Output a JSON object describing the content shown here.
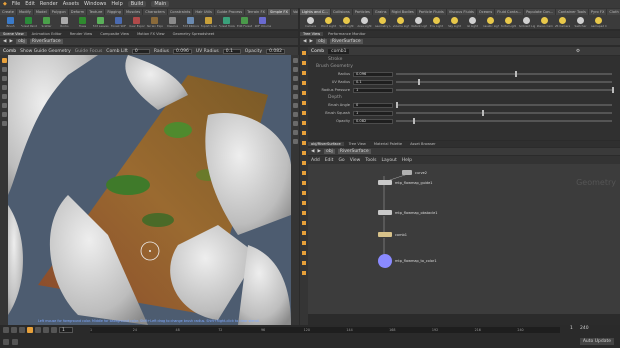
{
  "menu": {
    "items": [
      "File",
      "Edit",
      "Render",
      "Assets",
      "Windows",
      "Help"
    ],
    "build": "Build",
    "desktop": "Main"
  },
  "shelf_tabs_left": [
    "Create",
    "Modify",
    "Model",
    "Polygon",
    "Deform",
    "Texture",
    "Rigging",
    "Muscles",
    "Characters",
    "Constraints",
    "Hair Utils",
    "Guide Process",
    "Terrain FX",
    "Simple FX",
    "Volume"
  ],
  "shelf_tabs_right": [
    "Lights and C...",
    "Collisions",
    "Particles",
    "Grains",
    "Rigid Bodies",
    "Particle Fluids",
    "Viscous Fluids",
    "Oceans",
    "Fluid Conta...",
    "Populate Con...",
    "Container Tools",
    "Pyro FX",
    "Cloth",
    "Solid",
    "Wires",
    "Crowds",
    "Drive Simula..."
  ],
  "shelf_tools_left": [
    "Brush",
    "Forest Painter",
    "Scatter",
    "Rocks",
    "Trees",
    "Edit Leaves",
    "Forest SDF",
    "Clear Exports",
    "Terrain Export",
    "Dissolve",
    "Edit Ribbons",
    "Export Scene",
    "Forest Tools",
    "Edit Forest",
    "SDF Volume"
  ],
  "shelf_tools_right": [
    "Camera",
    "Point Light",
    "Spot Light",
    "Area Light",
    "Geometry Light",
    "Volume Light",
    "Distant Light",
    "Env Light",
    "Sky Light",
    "GI Light",
    "Caustic Light",
    "Portal Light",
    "Ambient Light",
    "Stereo Cam",
    "VR Camera",
    "Switcher",
    "Gamepad Camera"
  ],
  "left_panes": {
    "tabs": [
      "Scene View",
      "Animation Editor",
      "Render View",
      "Composite View",
      "Motion FX View",
      "Geometry Spreadsheet"
    ],
    "path": [
      "obj",
      "RiverSurface"
    ]
  },
  "viewport_toolbar": {
    "tool": "Comb",
    "show_guides": "Show Guide Geometry",
    "guide_mode": "Guide Focus",
    "comb_lift_label": "Comb Lift",
    "comb_lift_value": "0",
    "radius_label": "Radius",
    "radius_value": "0.096",
    "uv_radius_label": "UV Radius",
    "uv_radius_value": "0.1",
    "opacity_label": "Opacity",
    "opacity_value": "0.082"
  },
  "viewport": {
    "status": "Left mouse for foreground color. Middle for background color. Shift+Left drag to change brush radius. Shift+Right-click to clear stencil."
  },
  "right_top": {
    "tabs": [
      "Tree View",
      "Performance Monitor"
    ],
    "path": [
      "obj",
      "RiverSurface"
    ],
    "node_type": "Comb",
    "node_name": "comb1"
  },
  "params": [
    {
      "label": "Radius",
      "value": "0.096",
      "fraction": 0.55
    },
    {
      "label": "UV Radius",
      "value": "0.1",
      "fraction": 0.1
    },
    {
      "label": "Radius Pressure",
      "value": "1",
      "fraction": 1.0
    },
    {
      "label": "Brush Angle",
      "value": "0",
      "fraction": 0.0
    },
    {
      "label": "Brush Squash",
      "value": "1",
      "fraction": 0.4
    },
    {
      "label": "Opacity",
      "value": "0.082",
      "fraction": 0.08
    }
  ],
  "param_headers": [
    "Stroke",
    "Brush Geometry",
    "Depth"
  ],
  "network": {
    "tabs": [
      "obj/RiverSurface",
      "Tree View",
      "Material Palette",
      "Asset Browser"
    ],
    "path": [
      "obj",
      "RiverSurface"
    ],
    "menu": [
      "Add",
      "Edit",
      "Go",
      "View",
      "Tools",
      "Layout",
      "Help"
    ],
    "watermark": "Geometry",
    "nodes": [
      {
        "name": "curve2",
        "color": "#b0b0b0"
      },
      {
        "name": "mtp_flowmap_guide1",
        "color": "#c8c8c8"
      },
      {
        "name": "mtp_flowmap_obstacle1",
        "color": "#c8c8c8"
      },
      {
        "name": "comb1",
        "color": "#d8c28a"
      },
      {
        "name": "mtp_flowmap_to_color1",
        "color": "#8a8aff"
      }
    ]
  },
  "timeline": {
    "frame": "1",
    "ticks": [
      "1",
      "24",
      "48",
      "72",
      "96",
      "120",
      "144",
      "168",
      "192",
      "216",
      "240"
    ],
    "start": "1",
    "end": "240",
    "auto_update": "Auto Update"
  },
  "colors": {
    "accent_orange": "#e8a13a",
    "node_blue": "#8a8aff"
  }
}
